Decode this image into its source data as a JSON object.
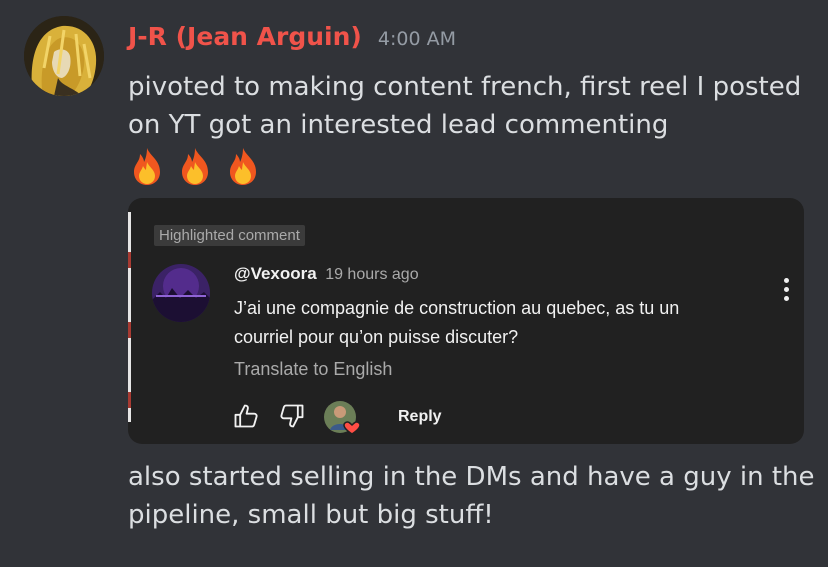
{
  "message": {
    "author": "J-R (Jean Arguin)",
    "author_color": "#f0534a",
    "timestamp": "4:00 AM",
    "text1": "pivoted to making content french, first reel I posted on YT got an interested lead commenting",
    "reactions_inline": [
      "fire-emoji",
      "fire-emoji",
      "fire-emoji"
    ],
    "text2": "also started selling in the DMs and have a guy in the pipeline, small but big stuff!"
  },
  "embed": {
    "badge": "Highlighted comment",
    "comment": {
      "handle": "@Vexoora",
      "time": "19 hours ago",
      "text": "J’ai une compagnie de construction au quebec, as tu un courriel pour qu’on puisse discuter?",
      "translate": "Translate to English",
      "reply": "Reply",
      "icons": [
        "thumbs-up-icon",
        "thumbs-down-icon",
        "creator-heart-icon",
        "more-vert-icon"
      ]
    }
  },
  "colors": {
    "background": "#313338",
    "embed_bg": "#212121",
    "text": "#dbdee1",
    "muted": "#949ba4"
  }
}
